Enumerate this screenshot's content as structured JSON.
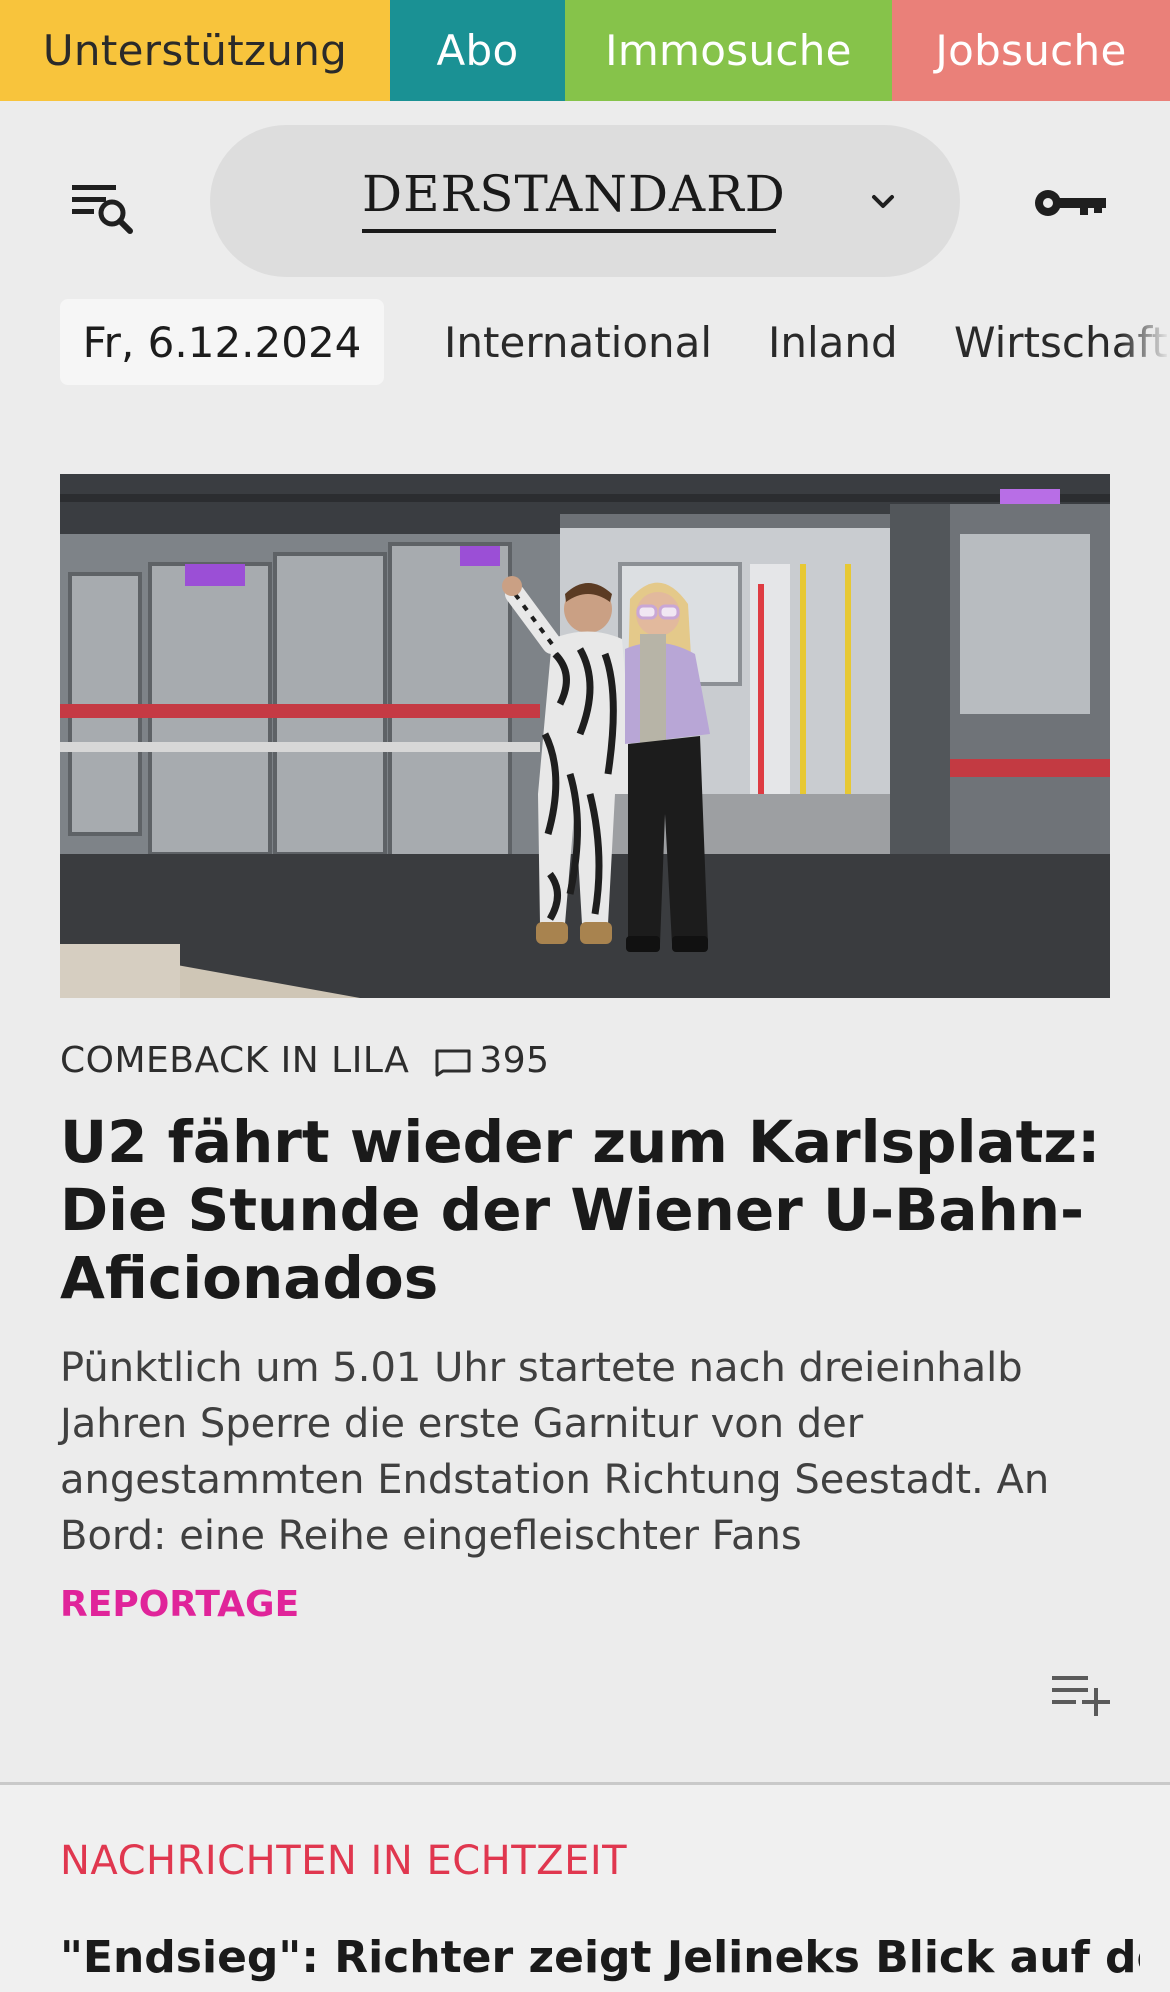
{
  "topbar": {
    "support": "Unterstützung",
    "abo": "Abo",
    "immo": "Immosuche",
    "jobs": "Jobsuche"
  },
  "header": {
    "logo_part1": "DER",
    "logo_part2": "STANDARD",
    "icons": {
      "menu": "menu-search-icon",
      "edition": "chevron-down-icon",
      "login": "key-icon"
    }
  },
  "nav": {
    "date": "Fr, 6.12.2024",
    "items": [
      "International",
      "Inland",
      "Wirtschaft"
    ]
  },
  "article": {
    "kicker": "COMEBACK IN LILA",
    "comment_count": "395",
    "headline": "U2 fährt wieder zum Karlsplatz: Die Stunde der Wiener U-Bahn-Aficionados",
    "teaser": "Pünktlich um 5.01 Uhr startete nach dreieinhalb Jahren Sperre die erste Garnitur von der angestammten Endstation Richtung Seestadt. An Bord: eine Reihe eingefleischter Fans",
    "tag": "REPORTAGE"
  },
  "live": {
    "section_title": "NACHRICHTEN IN ECHTZEIT",
    "first_headline": "\"Endsieg\": Richter zeigt Jelineks Blick auf den"
  },
  "colors": {
    "support": "#f8c43c",
    "abo": "#1a9194",
    "immo": "#86c34a",
    "jobs": "#ea8079",
    "tag": "#e0249a",
    "section": "#e0374f"
  }
}
